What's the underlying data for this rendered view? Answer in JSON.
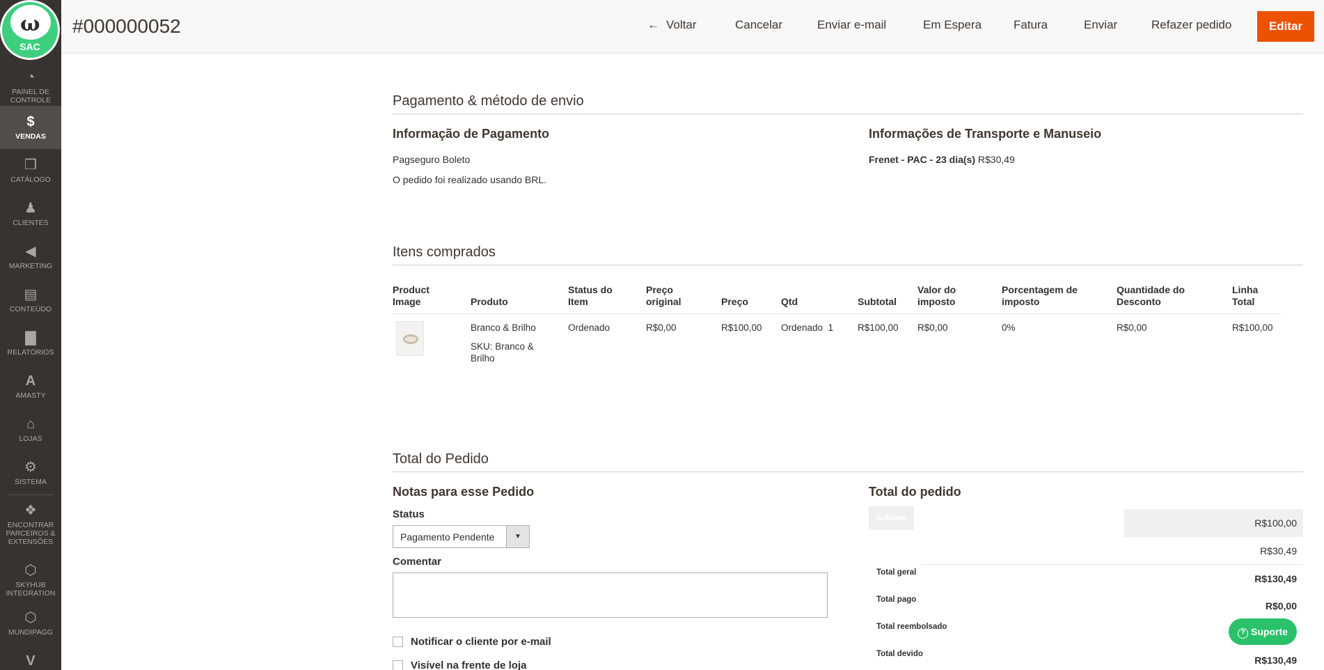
{
  "sidebar": {
    "logo_text": "SAC",
    "items": [
      {
        "label": "PAINEL DE",
        "label2": "CONTROLE",
        "icon": "dashboard-icon"
      },
      {
        "label": "VENDAS",
        "icon": "dollar-icon"
      },
      {
        "label": "CATÁLOGO",
        "icon": "box-icon"
      },
      {
        "label": "CLIENTES",
        "icon": "person-icon"
      },
      {
        "label": "MARKETING",
        "icon": "megaphone-icon"
      },
      {
        "label": "CONTEÚDO",
        "icon": "layout-icon"
      },
      {
        "label": "RELATÓRIOS",
        "icon": "bar-chart-icon"
      },
      {
        "label": "AMASTY",
        "icon": "amasty-icon"
      },
      {
        "label": "LOJAS",
        "icon": "store-icon"
      },
      {
        "label": "SISTEMA",
        "icon": "gear-icon"
      },
      {
        "label": "ENCONTRAR",
        "label2": "PARCEIROS &",
        "label3": "EXTENSÕES",
        "icon": "cube-icon"
      },
      {
        "label": "SKYHUB",
        "label2": "INTEGRATION",
        "icon": "hexagon-icon"
      },
      {
        "label": "MUNDIPAGG",
        "icon": "hexagon-icon"
      },
      {
        "label": "V",
        "icon": "v-icon"
      }
    ]
  },
  "header": {
    "order_number": "#000000052",
    "back_label": "Voltar",
    "buttons": [
      "Cancelar",
      "Enviar e-mail",
      "Em Espera",
      "Fatura",
      "Enviar",
      "Refazer pedido"
    ],
    "edit_label": "Editar"
  },
  "payment": {
    "section_title": "Pagamento & método de envio",
    "info_title": "Informação de Pagamento",
    "method": "Pagseguro Boleto",
    "currency_note": "O pedido foi realizado usando BRL.",
    "shipping_title": "Informações de Transporte e Manuseio",
    "shipping_method": "Frenet - PAC - 23 dia(s)",
    "shipping_price": "R$30,49"
  },
  "items": {
    "section_title": "Itens comprados",
    "headers": [
      [
        "Product",
        "Image"
      ],
      [
        "",
        "Produto"
      ],
      [
        "Status do",
        "Item"
      ],
      [
        "Preço",
        "original"
      ],
      [
        "",
        "Preço"
      ],
      [
        "",
        "Qtd"
      ],
      [
        "",
        "Subtotal"
      ],
      [
        "Valor do",
        "imposto"
      ],
      [
        "Porcentagem de",
        "imposto"
      ],
      [
        "Quantidade do",
        "Desconto"
      ],
      [
        "Linha",
        "Total"
      ]
    ],
    "row": {
      "product_name": "Branco & Brilho",
      "sku_line1": "SKU: Branco &",
      "sku_line2": "Brilho",
      "status": "Ordenado",
      "original_price": "R$0,00",
      "price": "R$100,00",
      "qty": "Ordenado  1",
      "subtotal": "R$100,00",
      "tax_amount": "R$0,00",
      "tax_percent": "0%",
      "discount": "R$0,00",
      "row_total": "R$100,00"
    }
  },
  "totals_section": {
    "section_title": "Total do Pedido",
    "notes_title": "Notas para esse Pedido",
    "status_label": "Status",
    "status_value": "Pagamento Pendente",
    "comment_label": "Comentar",
    "notify_label": "Notificar o cliente por e-mail",
    "visible_label": "Visível na frente de loja",
    "order_totals_title": "Total do pedido",
    "subtotal_label": "Subtotal",
    "subtotal_value": "R$100,00",
    "shipping_value": "R$30,49",
    "grand_total_label": "Total geral",
    "grand_total_value": "R$130,49",
    "paid_label": "Total pago",
    "paid_value": "R$0,00",
    "refunded_label": "Total reembolsado",
    "due_label": "Total devido",
    "due_value": "R$130,49"
  },
  "support_label": "Suporte"
}
